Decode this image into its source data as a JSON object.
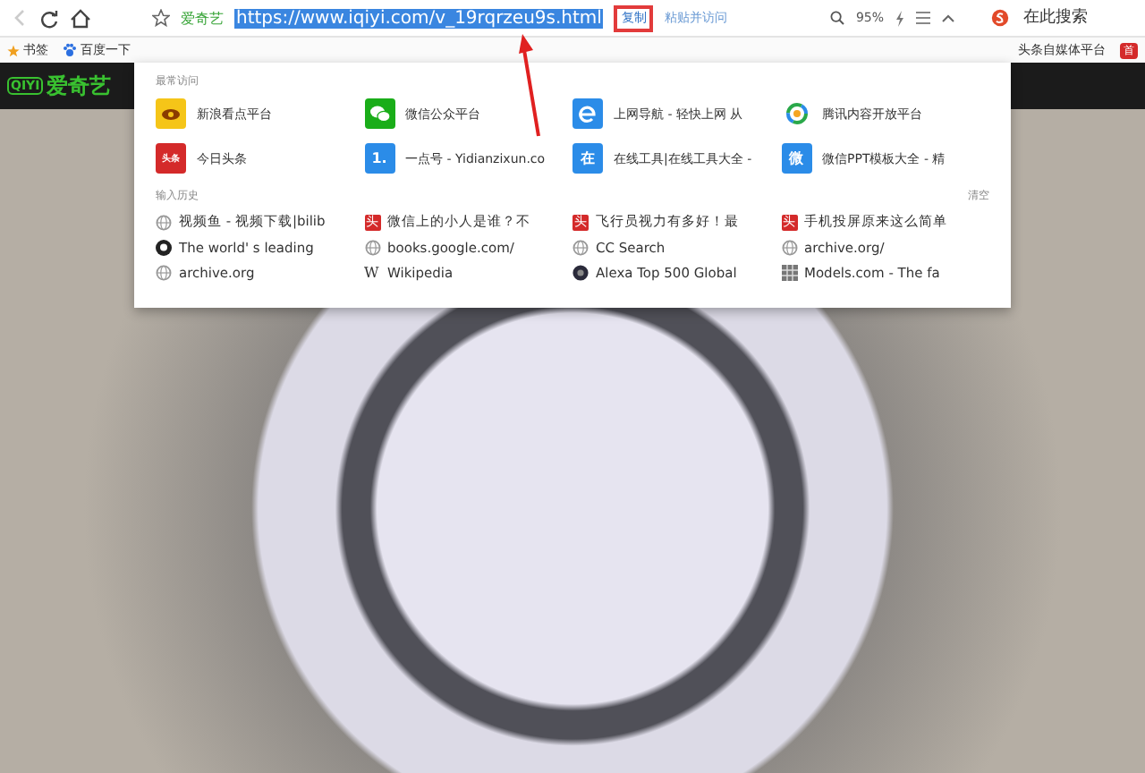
{
  "toolbar": {
    "back_disabled": true,
    "site_name": "爱奇艺",
    "url": "https://www.iqiyi.com/v_19rqrzeu9s.html",
    "url_selected": true,
    "copy_button": "复制",
    "paste_button": "粘贴并访问",
    "zoom": "95%",
    "search_placeholder": "在此搜索"
  },
  "bookmarks": {
    "left": [
      {
        "label": "书签",
        "kind": "star"
      },
      {
        "label": "百度一下",
        "kind": "paw"
      }
    ],
    "right": [
      {
        "label": "头条自媒体平台",
        "kind": "none"
      },
      {
        "label": "首",
        "kind": "red"
      }
    ]
  },
  "page": {
    "logo_mark": "QIYI",
    "logo": "爱奇艺"
  },
  "dropdown": {
    "frequent_title": "最常访问",
    "frequent": [
      {
        "label": "新浪看点平台",
        "kind": "sina",
        "color": "#f5c518"
      },
      {
        "label": "微信公众平台",
        "kind": "wechat",
        "color": "#1aad19"
      },
      {
        "label": "上网导航 - 轻快上网 从",
        "kind": "ie",
        "color": "#2b8ce8"
      },
      {
        "label": "腾讯内容开放平台",
        "kind": "tencent"
      },
      {
        "label": "今日头条",
        "kind": "glyph",
        "glyph": "头条",
        "color": "#d42a2a"
      },
      {
        "label": "一点号 - Yidianzixun.co",
        "kind": "glyph",
        "glyph": "1.",
        "color": "#2b8ce8"
      },
      {
        "label": "在线工具|在线工具大全 -",
        "kind": "glyph",
        "glyph": "在",
        "color": "#2b8ce8"
      },
      {
        "label": "微信PPT模板大全 - 精",
        "kind": "glyph",
        "glyph": "微",
        "color": "#2b8ce8"
      }
    ],
    "history_title": "输入历史",
    "clear": "清空",
    "history": [
      {
        "label": "视频鱼 - 视频下载|bilib",
        "kind": "globe"
      },
      {
        "label": "微信上的小人是谁？不",
        "kind": "glyph",
        "glyph": "头"
      },
      {
        "label": "飞行员视力有多好！最",
        "kind": "glyph",
        "glyph": "头"
      },
      {
        "label": "手机投屏原来这么简单",
        "kind": "glyph",
        "glyph": "头"
      },
      {
        "label": "The world' s leading",
        "kind": "github"
      },
      {
        "label": "books.google.com/",
        "kind": "globe"
      },
      {
        "label": "CC Search",
        "kind": "globe"
      },
      {
        "label": "archive.org/",
        "kind": "globe"
      },
      {
        "label": "archive.org",
        "kind": "globe"
      },
      {
        "label": "Wikipedia",
        "kind": "wiki",
        "glyph": "W"
      },
      {
        "label": "Alexa Top 500 Global",
        "kind": "alexa"
      },
      {
        "label": "Models.com - The fa",
        "kind": "models"
      }
    ]
  }
}
